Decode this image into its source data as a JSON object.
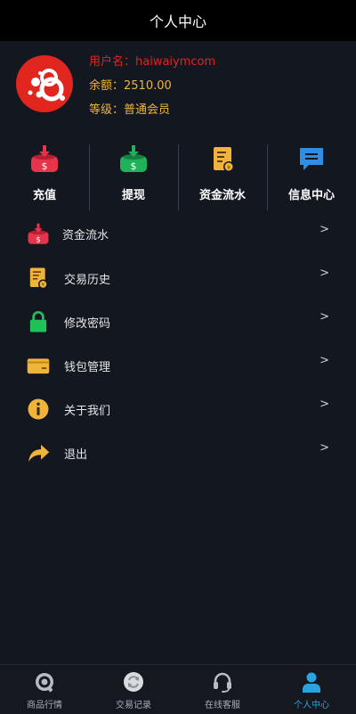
{
  "header": {
    "title": "个人中心"
  },
  "profile": {
    "username_line": "用户名：haiwaiymcom",
    "balance_line": "余额：2510.00",
    "level_line": "等级：普通会员"
  },
  "quick_actions": [
    {
      "label": "充值",
      "icon": "deposit-icon"
    },
    {
      "label": "提现",
      "icon": "withdraw-icon"
    },
    {
      "label": "资金流水",
      "icon": "fund-flow-icon"
    },
    {
      "label": "信息中心",
      "icon": "message-icon"
    }
  ],
  "menu": [
    {
      "label": "资金流水",
      "icon": "fund-flow-icon",
      "arrow": ">"
    },
    {
      "label": "交易历史",
      "icon": "trade-history-icon",
      "arrow": ">"
    },
    {
      "label": "修改密码",
      "icon": "lock-icon",
      "arrow": ">"
    },
    {
      "label": "钱包管理",
      "icon": "wallet-icon",
      "arrow": ">"
    },
    {
      "label": "关于我们",
      "icon": "info-icon",
      "arrow": ">"
    },
    {
      "label": "退出",
      "icon": "logout-icon",
      "arrow": ">"
    }
  ],
  "tabbar": [
    {
      "label": "商品行情",
      "icon": "market-icon",
      "active": false
    },
    {
      "label": "交易记录",
      "icon": "records-icon",
      "active": false
    },
    {
      "label": "在线客服",
      "icon": "headset-icon",
      "active": false
    },
    {
      "label": "个人中心",
      "icon": "user-icon",
      "active": true
    }
  ],
  "colors": {
    "background": "#131720",
    "header": "#000000",
    "username": "#e3231d",
    "gold": "#f0b43a",
    "active_tab": "#29a4e0",
    "deposit_red": "#e8344a",
    "withdraw_green": "#1fb25a",
    "message_blue": "#2f8de4",
    "lock_green": "#21c15a"
  }
}
